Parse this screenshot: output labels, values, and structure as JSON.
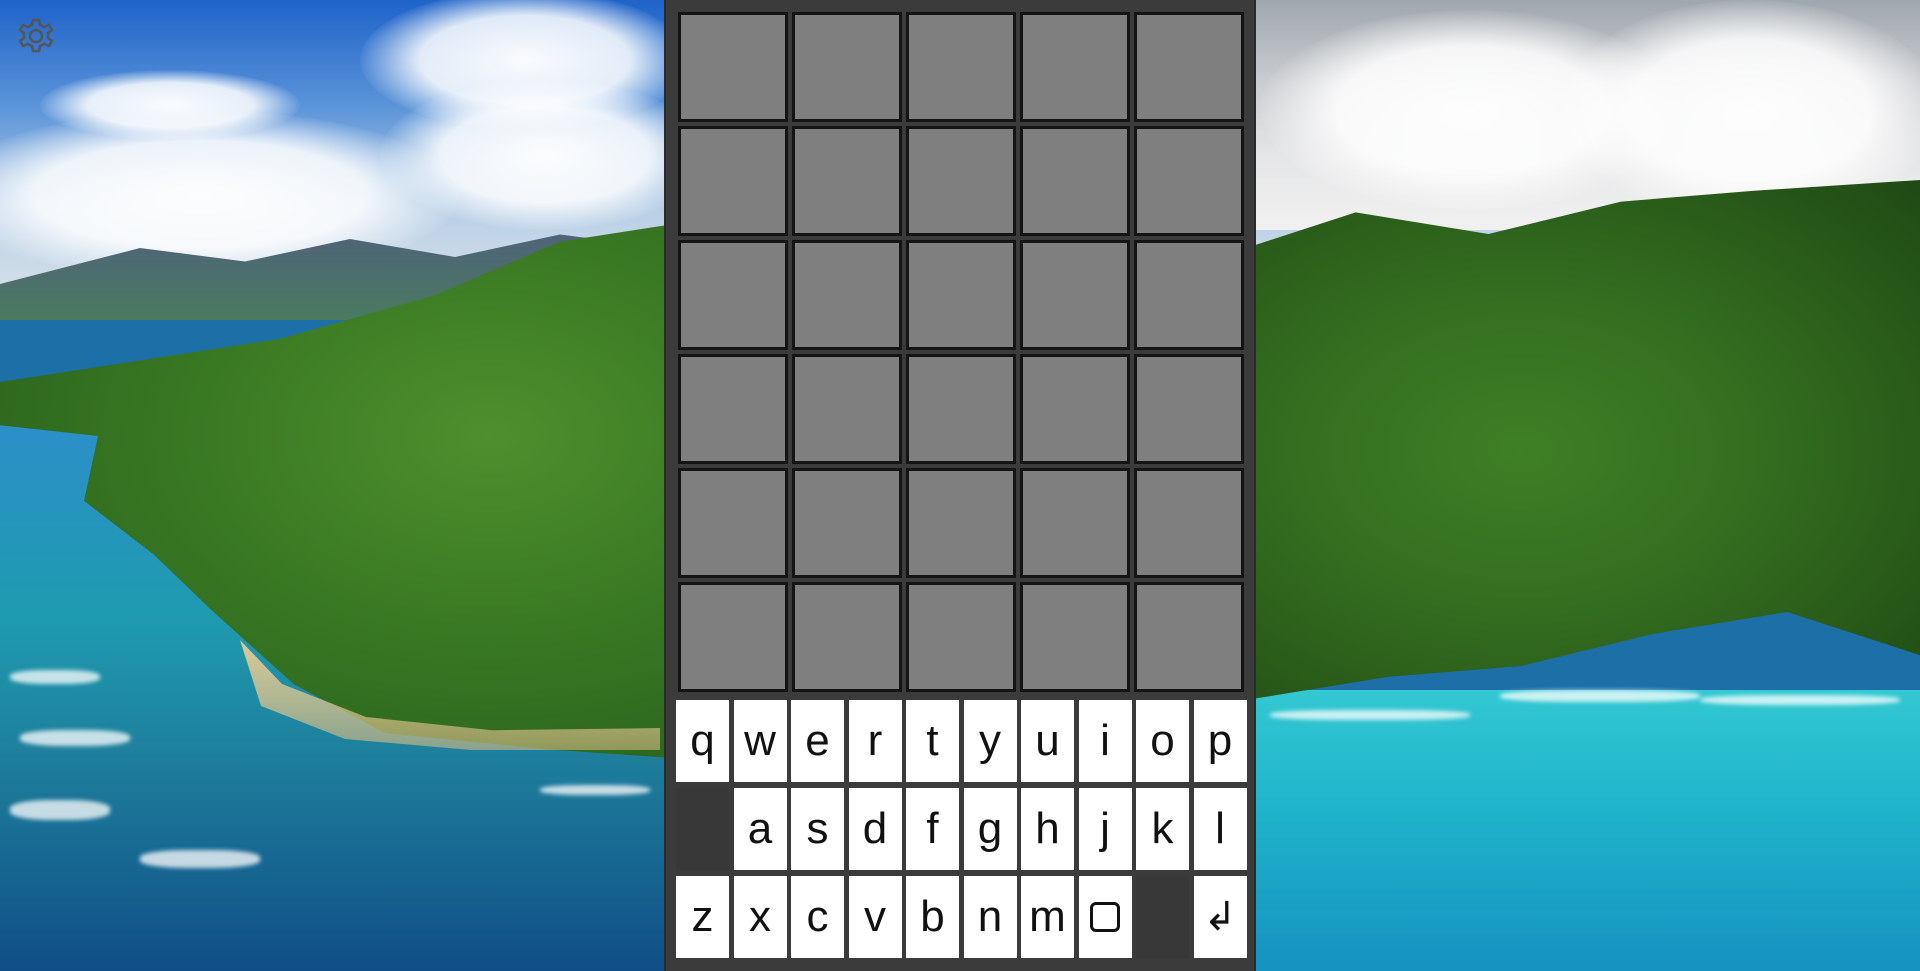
{
  "settings": {
    "icon": "gear-icon"
  },
  "board": {
    "rows": 6,
    "cols": 5,
    "tiles": [
      [
        "",
        "",
        "",
        "",
        ""
      ],
      [
        "",
        "",
        "",
        "",
        ""
      ],
      [
        "",
        "",
        "",
        "",
        ""
      ],
      [
        "",
        "",
        "",
        "",
        ""
      ],
      [
        "",
        "",
        "",
        "",
        ""
      ],
      [
        "",
        "",
        "",
        "",
        ""
      ]
    ],
    "tile_color": "#7f7f7f",
    "tile_border_color": "#141414"
  },
  "keyboard": {
    "row1": [
      "q",
      "w",
      "e",
      "r",
      "t",
      "y",
      "u",
      "i",
      "o",
      "p"
    ],
    "row2": [
      "a",
      "s",
      "d",
      "f",
      "g",
      "h",
      "j",
      "k",
      "l"
    ],
    "row3": [
      "z",
      "x",
      "c",
      "v",
      "b",
      "n",
      "m"
    ],
    "backspace_icon": "square-icon",
    "enter_label": "↲",
    "key_color": "#ffffff",
    "key_text_color": "#111111"
  },
  "panel_color": "#3b3b3b"
}
